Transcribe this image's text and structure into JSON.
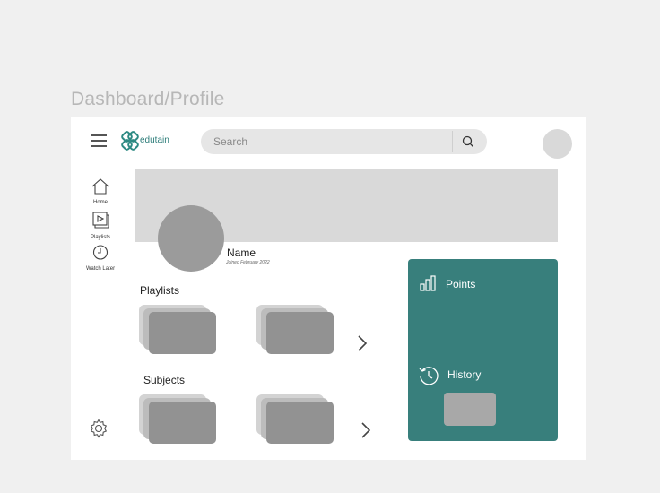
{
  "frame_label": "Dashboard/Profile",
  "header": {
    "brand": "edutain",
    "search_placeholder": "Search"
  },
  "sidebar": {
    "items": [
      {
        "label": "Home",
        "icon": "home-icon"
      },
      {
        "label": "Playlists",
        "icon": "playlist-icon"
      },
      {
        "label": "Watch Later",
        "icon": "clock-icon"
      }
    ],
    "settings_icon": "gear-icon"
  },
  "profile": {
    "name": "Name",
    "joined": "Joined February 2022"
  },
  "sections": {
    "playlists_title": "Playlists",
    "subjects_title": "Subjects"
  },
  "panel": {
    "points_label": "Points",
    "history_label": "History",
    "color": "#387f7c"
  }
}
